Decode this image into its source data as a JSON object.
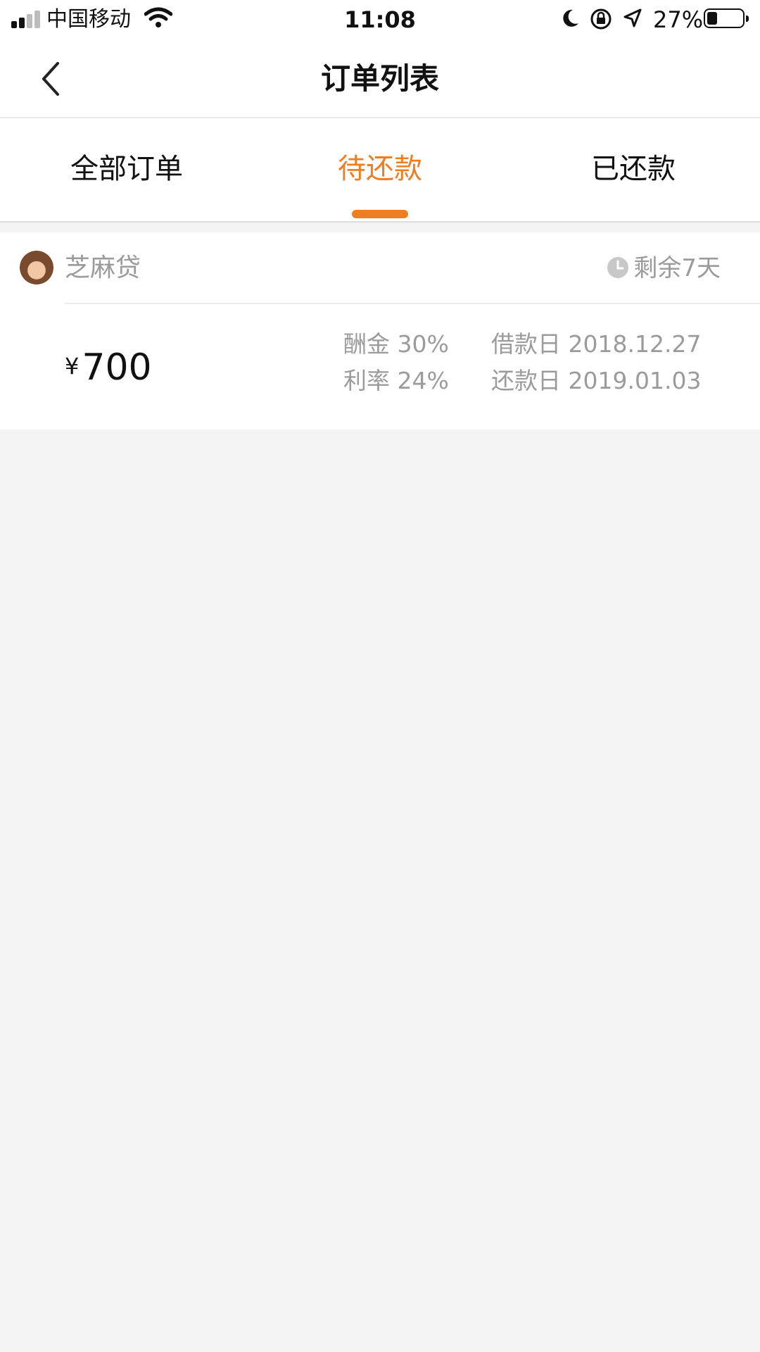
{
  "status_bar": {
    "carrier": "中国移动",
    "time": "11:08",
    "battery_percent": "27%",
    "icons": [
      "signal-icon",
      "wifi-icon",
      "moon-icon",
      "rotation-lock-icon",
      "location-arrow-icon",
      "battery-icon"
    ]
  },
  "header": {
    "back_icon": "chevron-left-icon",
    "title": "订单列表"
  },
  "tabs": [
    {
      "label": "全部订单",
      "active": false
    },
    {
      "label": "待还款",
      "active": true
    },
    {
      "label": "已还款",
      "active": false
    }
  ],
  "accent_color": "#ef7d22",
  "orders": [
    {
      "lender": "芝麻贷",
      "remaining": "剩余7天",
      "currency": "¥",
      "amount": "700",
      "commission_label": "酬金",
      "commission": "30%",
      "rate_label": "利率",
      "rate": "24%",
      "borrow_date_label": "借款日",
      "borrow_date": "2018.12.27",
      "repay_date_label": "还款日",
      "repay_date": "2019.01.03"
    }
  ]
}
